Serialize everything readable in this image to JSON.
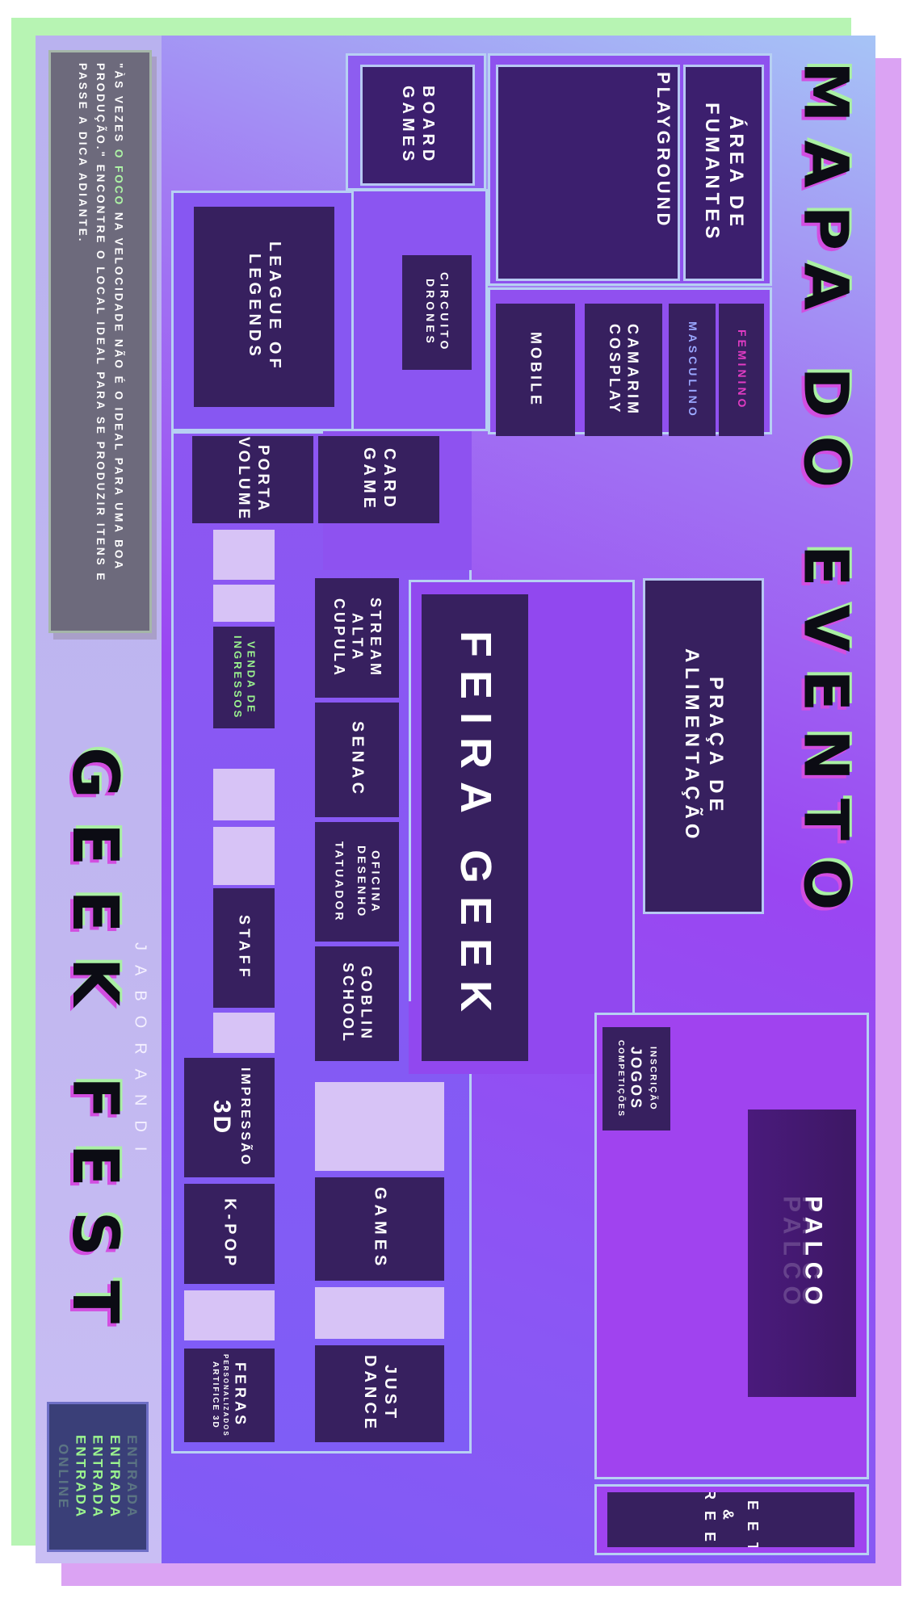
{
  "title": "MAPA DO EVENTO",
  "event": {
    "name": "GEEK FEST",
    "city": "JABORANDI"
  },
  "quote": {
    "before": "\"ÀS VEZES ",
    "highlight": "O FOCO",
    "after": " NA VELOCIDADE NÃO É O IDEAL PARA UMA BOA PRODUÇÃO.\" ENCONTRE O LOCAL IDEAL PARA SE PRODUZIR ITENS E PASSE A DICA ADIANTE."
  },
  "rooms": {
    "area_fumantes": "ÁREA DE FUMANTES",
    "playground": "PLAYGROUND",
    "board_games": "BOARD GAMES",
    "feminino": "FEMININO",
    "masculino": "MASCULINO",
    "camarim": "CAMARIM COSPLAY",
    "mobile": "MOBILE",
    "circuito_drones": "CIRCUITO DRONES",
    "league": "LEAGUE OF LEGENDS",
    "card_game": "CARD GAME",
    "porta_volume": "PORTA VOLUME",
    "venda_ingressos": "VENDA DE INGRESSOS",
    "stream": "STREAM ALTA CUPULA",
    "senac": "SENAC",
    "oficina": "OFICINA DESENHO",
    "tatuador": "TATUADOR",
    "goblin": "GOBLIN SCHOOL",
    "staff": "STAFF",
    "feira_geek": "FEIRA GEEK",
    "praca": "PRAÇA DE ALIMENTAÇÃO",
    "inscricao_top": "INSCRIÇÃO",
    "inscricao_mid": "JOGOS",
    "inscricao_bottom": "COMPETIÇÕES",
    "palco": "PALCO",
    "impressao_top": "IMPRESSÃO",
    "impressao_main": "3D",
    "kpop": "K-POP",
    "games": "GAMES",
    "feras": "FERAS",
    "feras_sub1": "PERSONALIZADOS",
    "feras_sub2": "ARTIFICE 3D",
    "just_dance": "JUST DANCE",
    "meet_greet_1": "MEET",
    "meet_greet_2": "& GREET",
    "entrada": "ENTRADA",
    "entrada_ghost": "ENTRADA",
    "online": "ONLINE"
  },
  "colors": {
    "room": "#3c1f6e",
    "border": "#b7c8f3",
    "accent_green": "#9cf58f",
    "accent_pink": "#e23cc4",
    "accent_blue": "#9aa8ff"
  }
}
